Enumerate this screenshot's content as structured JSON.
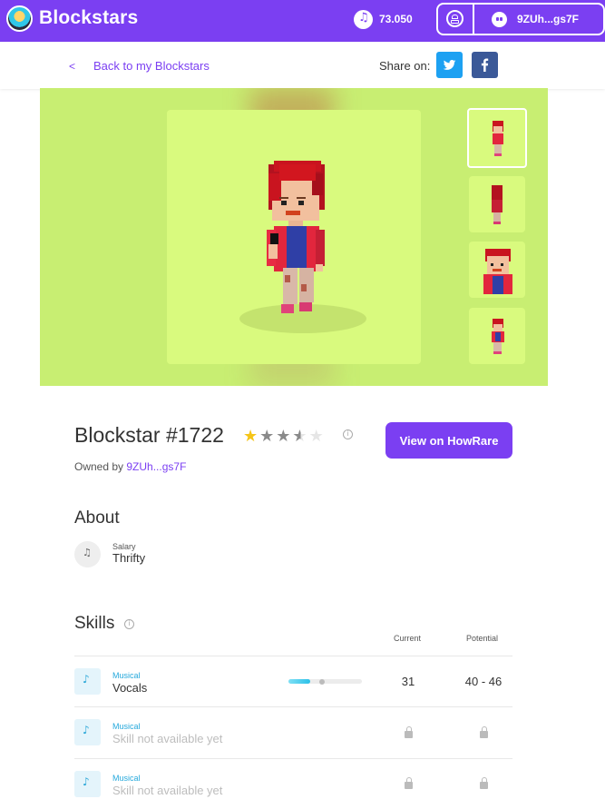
{
  "header": {
    "brand": "Blockstars",
    "balance": "73.050",
    "wallet_short": "9ZUh...gs7F"
  },
  "subheader": {
    "back_chevron": "<",
    "back_label": "Back to my Blockstars",
    "share_label": "Share on:"
  },
  "gallery": {
    "thumbnail_count": 4,
    "active_thumbnail": 1
  },
  "nft": {
    "title": "Blockstar #1722",
    "rating": 3.5,
    "rating_max": 5,
    "owned_by_label": "Owned by",
    "owner_short": "9ZUh...gs7F",
    "howrare_button": "View on HowRare"
  },
  "about": {
    "heading": "About",
    "salary_label": "Salary",
    "salary_value": "Thrifty"
  },
  "skills": {
    "heading": "Skills",
    "col_current": "Current",
    "col_potential": "Potential",
    "rows": [
      {
        "category": "Musical",
        "name": "Vocals",
        "current": "31",
        "potential": "40 - 46",
        "bar_fill": 0.3,
        "bar_marker": 0.42,
        "available": true
      },
      {
        "category": "Musical",
        "name": "Skill not available yet",
        "available": false
      },
      {
        "category": "Musical",
        "name": "Skill not available yet",
        "available": false
      }
    ]
  },
  "colors": {
    "brand_purple": "#7b3ff2",
    "gallery_bg": "#c8ee72",
    "twitter": "#1da1f2",
    "facebook": "#3b5998",
    "skill_accent": "#26a9dc",
    "star_gold": "#f5c518"
  },
  "icons": [
    "music-note-icon",
    "profile-icon",
    "ghost-wallet-icon",
    "twitter-icon",
    "facebook-icon",
    "info-icon",
    "salary-icon",
    "lock-icon",
    "star-icon"
  ]
}
